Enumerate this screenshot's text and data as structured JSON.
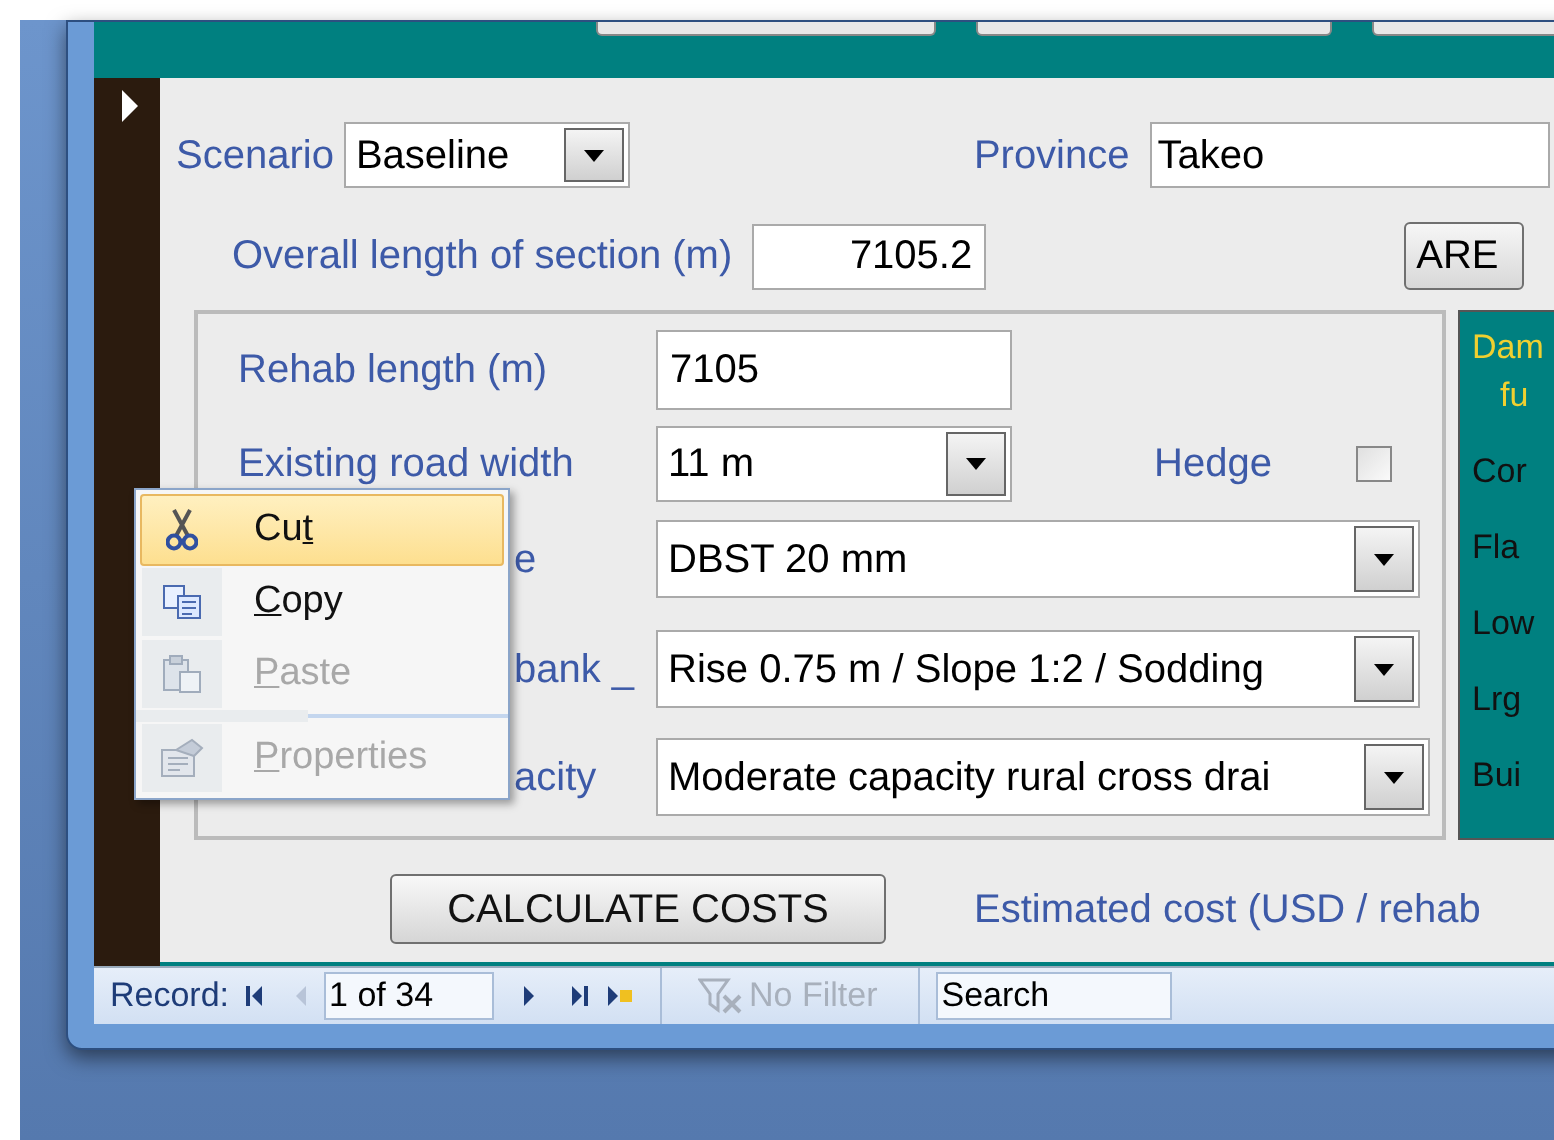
{
  "form": {
    "scenario": {
      "label": "Scenario",
      "value": "Baseline"
    },
    "province": {
      "label": "Province",
      "value": "Takeo"
    },
    "overall_length": {
      "label": "Overall length of section (m)",
      "value": "7105.2"
    },
    "area_button": "ARE",
    "section": {
      "fields": [
        {
          "kind": "text",
          "label": "Rehab length (m)",
          "value": "7105"
        },
        {
          "kind": "combo",
          "label": "Existing road width",
          "value": "11 m"
        },
        {
          "kind": "combo",
          "label": "e",
          "value": "DBST 20 mm"
        },
        {
          "kind": "combo",
          "label": "bank _",
          "value": "Rise 0.75 m / Slope 1:2 / Sodding"
        },
        {
          "kind": "combo",
          "label": "acity",
          "value": "Moderate capacity rural cross drai"
        }
      ],
      "hedge": {
        "label": "Hedge",
        "checked": false
      }
    },
    "side_panel": {
      "heading": [
        "Dam",
        "fu"
      ],
      "items": [
        "Cor",
        "Fla",
        "Low",
        "Lrg",
        "Bui"
      ]
    },
    "calculate_button": "CALCULATE COSTS",
    "estimated_cost_label": "Estimated cost (USD / rehab"
  },
  "status_bar": {
    "record_label": "Record:",
    "position": "1 of 34",
    "filter": {
      "label": "No Filter",
      "disabled": true
    },
    "search": "Search"
  },
  "context_menu": [
    {
      "kind": "item",
      "before": "Cu",
      "key": "t",
      "selected": true,
      "disabled": false
    },
    {
      "kind": "item",
      "key": "C",
      "after": "opy",
      "selected": false,
      "disabled": false
    },
    {
      "kind": "item",
      "key": "P",
      "after": "aste",
      "selected": false,
      "disabled": true
    },
    {
      "kind": "separator"
    },
    {
      "kind": "item",
      "key": "P",
      "after": "roperties",
      "selected": false,
      "disabled": true
    }
  ]
}
